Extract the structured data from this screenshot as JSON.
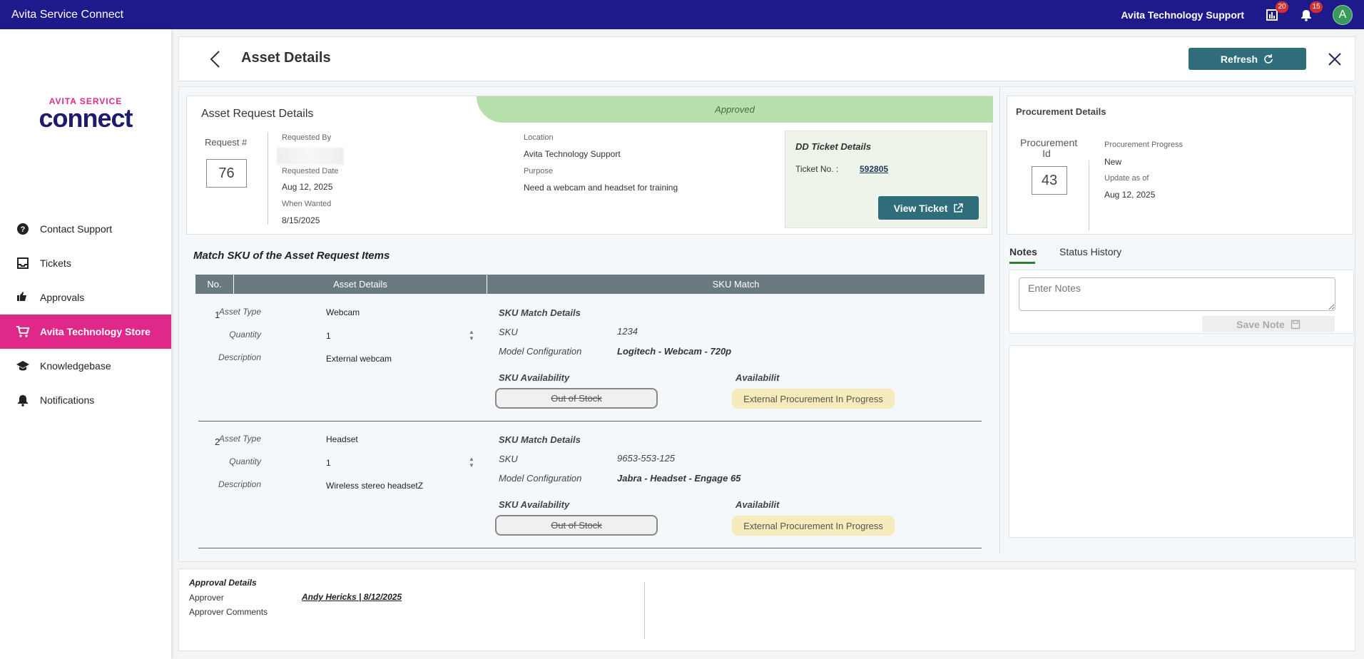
{
  "topbar": {
    "app_title": "Avita Service Connect",
    "org_name": "Avita Technology Support",
    "reports_badge": "20",
    "notifications_badge": "15",
    "avatar_initial": "A"
  },
  "logo": {
    "line1": "AVITA SERVICE",
    "line2": "connect"
  },
  "sidebar": {
    "items": [
      {
        "label": "Contact Support",
        "icon": "help-circle-icon"
      },
      {
        "label": "Tickets",
        "icon": "inbox-icon"
      },
      {
        "label": "Approvals",
        "icon": "thumbs-icon"
      },
      {
        "label": "Avita Technology Store",
        "icon": "cart-icon",
        "active": true
      },
      {
        "label": "Knowledgebase",
        "icon": "graduation-cap-icon"
      },
      {
        "label": "Notifications",
        "icon": "bell-icon"
      }
    ]
  },
  "header": {
    "title": "Asset Details",
    "refresh_label": "Refresh"
  },
  "request": {
    "title": "Asset Request Details",
    "status": "Approved",
    "request_num_label": "Request #",
    "request_num": "76",
    "requested_by_label": "Requested By",
    "requested_date_label": "Requested Date",
    "requested_date": "Aug 12, 2025",
    "when_wanted_label": "When Wanted",
    "when_wanted": "8/15/2025",
    "location_label": "Location",
    "location": "Avita Technology Support",
    "purpose_label": "Purpose",
    "purpose": "Need a webcam and headset for training"
  },
  "dd_ticket": {
    "title": "DD Ticket Details",
    "ticket_label": "Ticket No. :",
    "ticket_no": "592805",
    "view_label": "View Ticket"
  },
  "match": {
    "title": "Match SKU of the Asset Request Items",
    "columns": [
      "No.",
      "Asset Details",
      "SKU Match"
    ],
    "labels": {
      "asset_type": "Asset Type",
      "quantity": "Quantity",
      "description": "Description",
      "sku_match_details": "SKU Match Details",
      "sku": "SKU",
      "model_config": "Model Configuration",
      "sku_availability": "SKU Availability",
      "availability": "Availabilit"
    },
    "items": [
      {
        "no": "1",
        "asset_type": "Webcam",
        "quantity": "1",
        "description": "External webcam",
        "sku": "1234",
        "model": "Logitech - Webcam - 720p",
        "sku_availability": "Out of Stock",
        "availability": "External Procurement In Progress"
      },
      {
        "no": "2",
        "asset_type": "Headset",
        "quantity": "1",
        "description": "Wireless stereo headsetZ",
        "sku": "9653-553-125",
        "model": "Jabra - Headset - Engage 65",
        "sku_availability": "Out of Stock",
        "availability": "External Procurement In Progress"
      }
    ]
  },
  "procurement": {
    "title": "Procurement Details",
    "id_label": "Procurement Id",
    "id": "43",
    "progress_label": "Procurement Progress",
    "progress": "New",
    "update_label": "Update as of",
    "update_date": "Aug 12, 2025"
  },
  "notes": {
    "tabs": [
      "Notes",
      "Status History"
    ],
    "placeholder": "Enter Notes",
    "save_label": "Save Note"
  },
  "approval": {
    "title": "Approval Details",
    "approver_label": "Approver",
    "approver_value": "Andy Hericks | 8/12/2025",
    "comments_label": "Approver Comments"
  }
}
